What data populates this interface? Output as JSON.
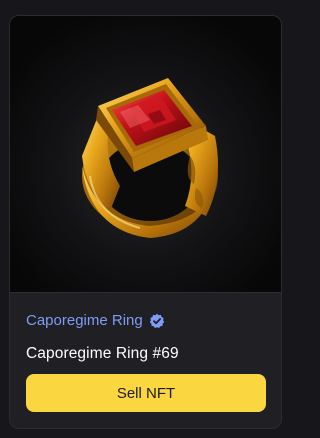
{
  "card": {
    "image": {
      "subject_icon": "gold-ruby-signet-ring",
      "background_color": "#070708"
    },
    "collection": {
      "name": "Caporegime Ring",
      "verified_icon": "verified-check-badge-icon",
      "color": "#7f9bf5"
    },
    "nft_name": "Caporegime Ring #69",
    "sell_button": {
      "label": "Sell NFT",
      "color": "#fad740"
    }
  }
}
